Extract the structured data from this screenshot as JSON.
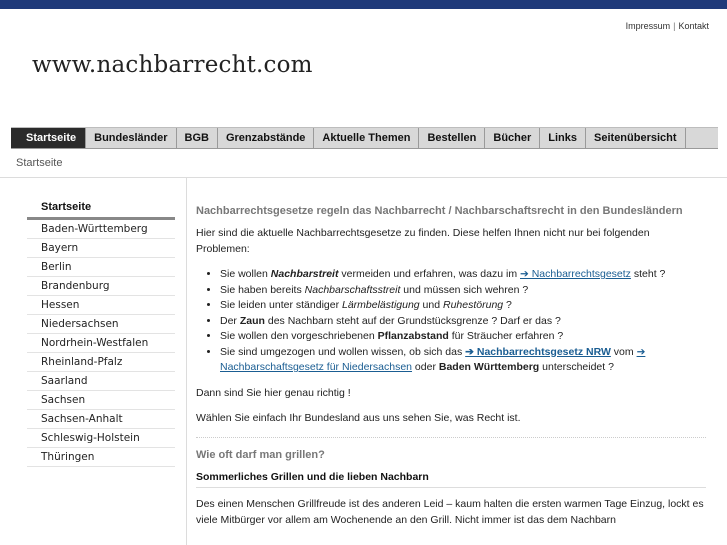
{
  "top_links": {
    "impressum": "Impressum",
    "kontakt": "Kontakt",
    "separator": "|"
  },
  "logo": "www.nachbarrecht.com",
  "nav": [
    "Startseite",
    "Bundesländer",
    "BGB",
    "Grenzabstände",
    "Aktuelle Themen",
    "Bestellen",
    "Bücher",
    "Links",
    "Seitenübersicht"
  ],
  "breadcrumb": "Startseite",
  "sidebar": {
    "heading": "Startseite",
    "items": [
      "Baden-Württemberg",
      "Bayern",
      "Berlin",
      "Brandenburg",
      "Hessen",
      "Niedersachsen",
      "Nordrhein-Westfalen",
      "Rheinland-Pfalz",
      "Saarland",
      "Sachsen",
      "Sachsen-Anhalt",
      "Schleswig-Holstein",
      "Thüringen"
    ]
  },
  "content": {
    "h1": "Nachbarrechtsgesetze regeln das Nachbarrecht / Nachbarschaftsrecht in den Bundesländern",
    "intro": "Hier sind die aktuelle Nachbarrechtsgesetze zu finden. Diese helfen Ihnen nicht nur bei folgenden Problemen:",
    "b1": {
      "t1": "Sie wollen ",
      "em": "Nachbarstreit",
      "t2": " vermeiden und erfahren, was dazu im ",
      "link": "➔ Nachbarrechtsgesetz",
      "t3": " steht ?"
    },
    "b2": {
      "t1": "Sie haben bereits ",
      "em": "Nachbarschaftsstreit",
      "t2": " und müssen sich wehren ?"
    },
    "b3": {
      "t1": "Sie leiden unter ständiger ",
      "em1": "Lärmbelästigung",
      "t2": " und ",
      "em2": "Ruhestörung",
      "t3": " ?"
    },
    "b4": {
      "t1": "Der ",
      "strong": "Zaun",
      "t2": " des Nachbarn steht auf der Grundstücksgrenze ? Darf er das ?"
    },
    "b5": {
      "t1": "Sie wollen den vorgeschriebenen ",
      "strong": "Pflanzabstand",
      "t2": " für Sträucher erfahren ?"
    },
    "b6": {
      "t1": "Sie sind umgezogen und wollen wissen, ob sich das ",
      "link1": "➔ Nachbarrechtsgesetz NRW",
      "t2": " vom ",
      "link2": "➔ Nachbarschaftsgesetz für Niedersachsen",
      "t3": " oder ",
      "strong": "Baden Württemberg",
      "t4": " unterscheidet ?"
    },
    "p2": "Dann sind Sie hier genau richtig !",
    "p3": "Wählen Sie einfach Ihr Bundesland aus uns sehen Sie, was Recht ist.",
    "h2": "Wie oft darf man grillen?",
    "h3": "Sommerliches Grillen und die lieben Nachbarn",
    "p4": "Des einen Menschen Grillfreude ist des anderen Leid – kaum halten die ersten warmen Tage Einzug, lockt es viele Mitbürger vor allem am Wochenende an den Grill. Nicht immer ist das dem Nachbarn"
  }
}
